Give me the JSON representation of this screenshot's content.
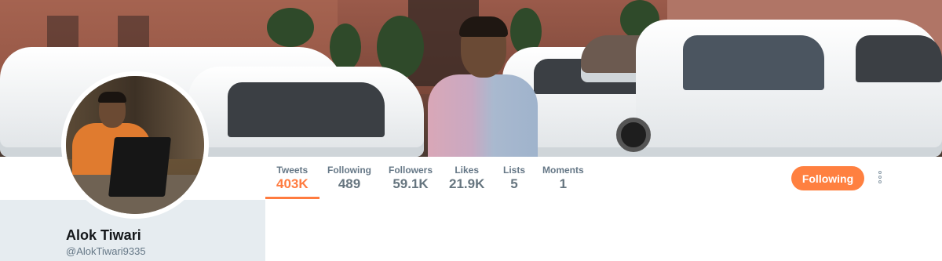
{
  "profile": {
    "name": "Alok Tiwari",
    "handle": "@AlokTiwari9335"
  },
  "stats": [
    {
      "label": "Tweets",
      "value": "403K",
      "active": true
    },
    {
      "label": "Following",
      "value": "489",
      "active": false
    },
    {
      "label": "Followers",
      "value": "59.1K",
      "active": false
    },
    {
      "label": "Likes",
      "value": "21.9K",
      "active": false
    },
    {
      "label": "Lists",
      "value": "5",
      "active": false
    },
    {
      "label": "Moments",
      "value": "1",
      "active": false
    }
  ],
  "actions": {
    "follow_label": "Following",
    "more_icon": "vertical-dots-icon"
  },
  "colors": {
    "accent": "#ff7b3f",
    "follow_button": "#ff8040",
    "muted_text": "#657786",
    "background": "#e6ecf0"
  }
}
